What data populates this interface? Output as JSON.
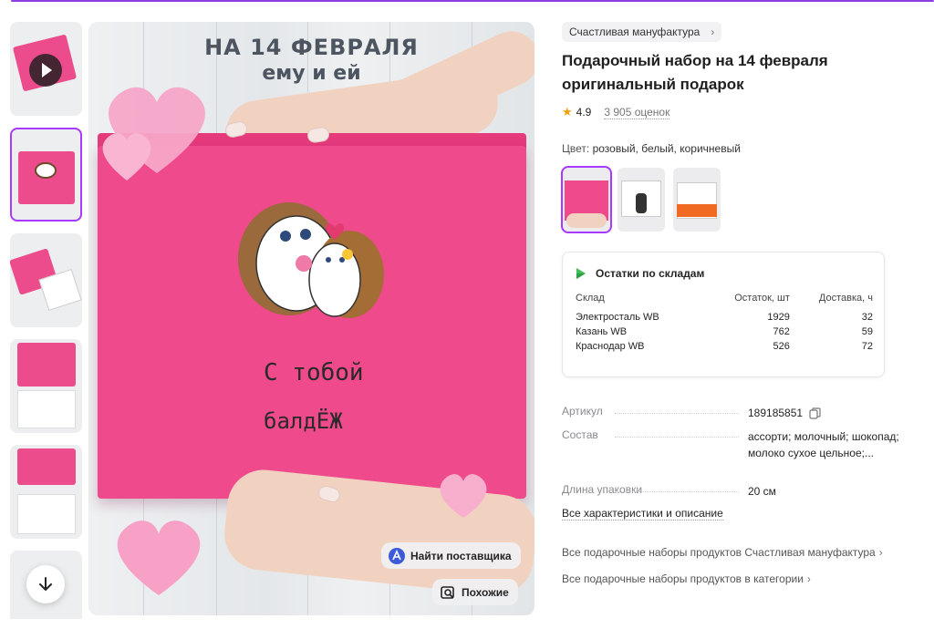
{
  "gallery": {
    "thumbnails": [
      {
        "id": "video",
        "kind": "video"
      },
      {
        "id": "cover",
        "kind": "image",
        "active": true
      },
      {
        "id": "open-box",
        "kind": "image"
      },
      {
        "id": "box-inside",
        "kind": "image"
      },
      {
        "id": "box-cards",
        "kind": "image"
      },
      {
        "id": "more",
        "kind": "image"
      }
    ],
    "scroll_icon": "arrow-down-icon"
  },
  "main_image": {
    "headline_line1": "НА 14 ФЕВРАЛЯ",
    "headline_line2": "ему и ей",
    "box_text_line1": "С тобой",
    "box_text_line2": "балдЁЖ",
    "find_supplier_label": "Найти поставщика",
    "similar_label": "Похожие"
  },
  "product": {
    "brand": "Счастливая мануфактура",
    "title": "Подарочный набор на 14 февраля оригинальный подарок",
    "rating": "4.9",
    "ratings_count": "3 905 оценок",
    "color_label": "Цвет:",
    "color_value": "розовый, белый, коричневый",
    "variants": [
      {
        "id": "pink",
        "active": true
      },
      {
        "id": "white"
      },
      {
        "id": "kus-tebya"
      }
    ]
  },
  "stock": {
    "title": "Остатки по складам",
    "columns": [
      "Склад",
      "Остаток, шт",
      "Доставка, ч"
    ],
    "rows": [
      {
        "warehouse": "Электросталь WB",
        "qty": "1929",
        "delivery": "32"
      },
      {
        "warehouse": "Казань WB",
        "qty": "762",
        "delivery": "59"
      },
      {
        "warehouse": "Краснодар WB",
        "qty": "526",
        "delivery": "72"
      }
    ]
  },
  "specs": {
    "article_label": "Артикул",
    "article_value": "189185851",
    "composition_label": "Состав",
    "composition_value": "ассорти; молочный; шокопад; молоко сухое цельное;...",
    "length_label": "Длина упаковки",
    "length_value": "20 см",
    "all_chars_link": "Все характеристики и описание"
  },
  "links": {
    "brand_all": "Все подарочные наборы продуктов Счастливая мануфактура",
    "category_all": "Все подарочные наборы продуктов в категории"
  },
  "colors": {
    "accent": "#a73afd",
    "box_pink": "#ef4a8b",
    "star": "#f59e0b"
  }
}
